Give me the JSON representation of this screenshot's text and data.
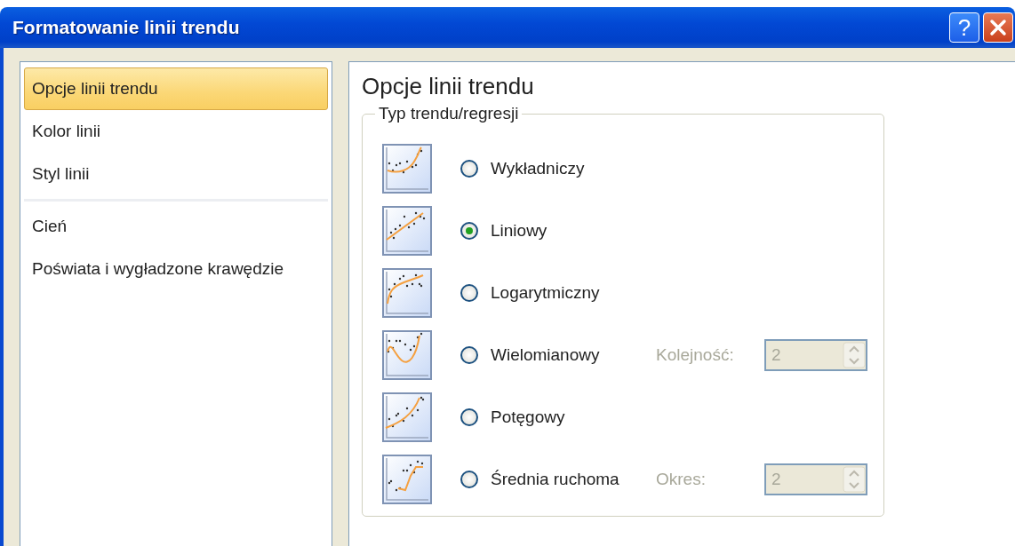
{
  "window": {
    "title": "Formatowanie linii trendu",
    "help_button": "?"
  },
  "sidebar": {
    "groups": [
      [
        {
          "label": "Opcje linii trendu",
          "selected": true
        },
        {
          "label": "Kolor linii",
          "selected": false
        },
        {
          "label": "Styl linii",
          "selected": false
        }
      ],
      [
        {
          "label": "Cień",
          "selected": false
        },
        {
          "label": "Poświata i wygładzone krawędzie",
          "selected": false
        }
      ]
    ]
  },
  "panel": {
    "heading": "Opcje linii trendu",
    "group_title": "Typ trendu/regresji",
    "options": [
      {
        "kind": "exponential",
        "label": "Wykładniczy",
        "selected": false
      },
      {
        "kind": "linear",
        "label": "Liniowy",
        "selected": true
      },
      {
        "kind": "logarithmic",
        "label": "Logarytmiczny",
        "selected": false
      },
      {
        "kind": "polynomial",
        "label": "Wielomianowy",
        "selected": false,
        "parameter": {
          "label": "Kolejność:",
          "value": "2",
          "disabled": true
        }
      },
      {
        "kind": "power",
        "label": "Potęgowy",
        "selected": false
      },
      {
        "kind": "average",
        "label": "Średnia ruchoma",
        "selected": false,
        "parameter": {
          "label": "Okres:",
          "value": "2",
          "disabled": true
        }
      }
    ]
  }
}
